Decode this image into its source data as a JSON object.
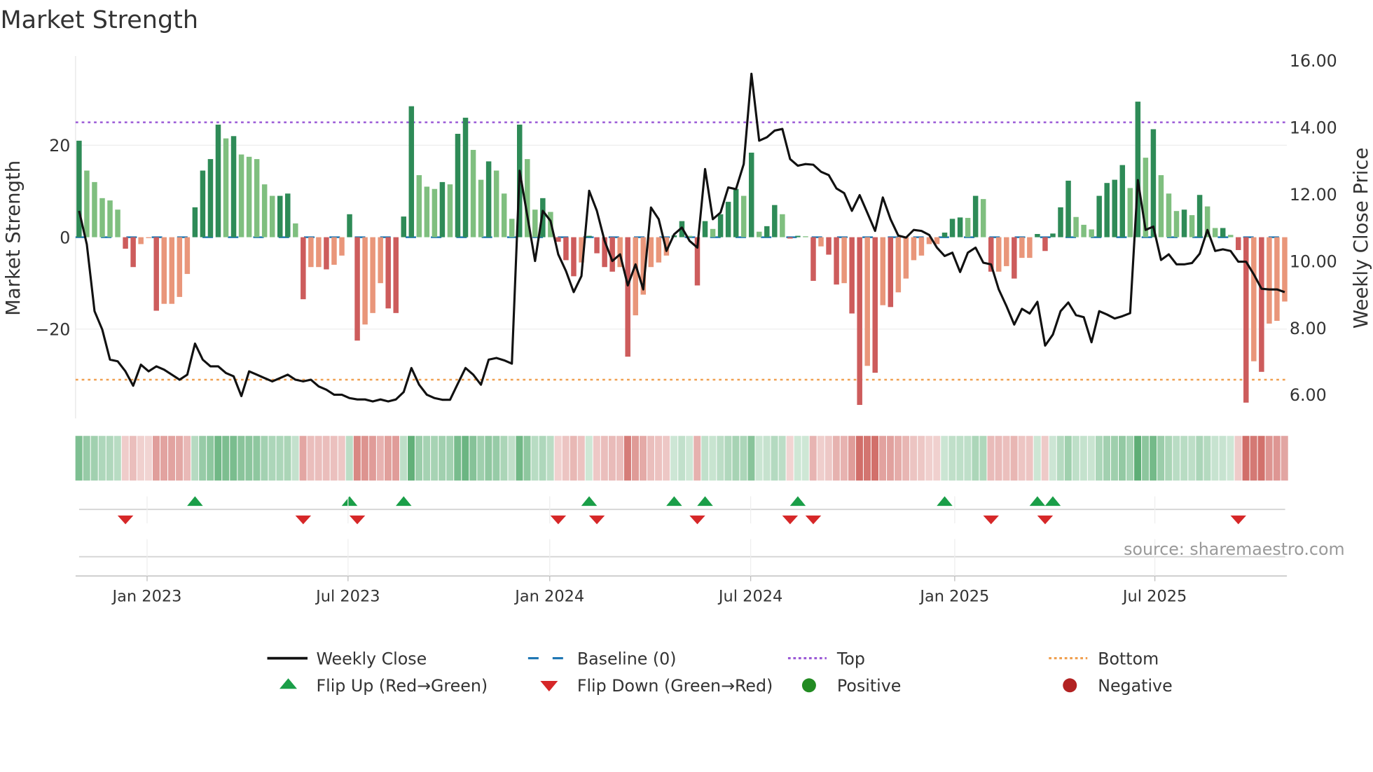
{
  "chart_data": {
    "type": "bar",
    "title": "Market Strength",
    "ylabel": "Market Strength",
    "y2label": "Weekly Close Price",
    "ylim": [
      -36.5,
      30
    ],
    "y2lim": [
      5.5,
      16.2
    ],
    "yticks": [
      {
        "v": 20,
        "label": "20"
      },
      {
        "v": 0,
        "label": "0"
      },
      {
        "v": -20,
        "label": "−20"
      }
    ],
    "y2ticks": [
      {
        "v": 16,
        "label": "16.00"
      },
      {
        "v": 14,
        "label": "14.00"
      },
      {
        "v": 12,
        "label": "12.00"
      },
      {
        "v": 10,
        "label": "10.00"
      },
      {
        "v": 8,
        "label": "8.00"
      },
      {
        "v": 6,
        "label": "6.00"
      }
    ],
    "xticks": [
      {
        "week": 8.8,
        "label": "Jan 2023"
      },
      {
        "week": 34.8,
        "label": "Jul 2023"
      },
      {
        "week": 60.9,
        "label": "Jan 2024"
      },
      {
        "week": 86.9,
        "label": "Jul 2024"
      },
      {
        "week": 113.3,
        "label": "Jan 2025"
      },
      {
        "week": 139.2,
        "label": "Jul 2025"
      }
    ],
    "top_level": 25,
    "bottom_level": -31,
    "baseline": 0,
    "strength": [
      21,
      14.5,
      12,
      8.5,
      8,
      6,
      -2.5,
      -6.5,
      -1.5,
      -0.2,
      -16,
      -14.5,
      -14.5,
      -13,
      -8,
      6.5,
      14.5,
      17,
      24.5,
      21.5,
      22,
      18,
      17.5,
      17,
      11.5,
      9,
      9,
      9.5,
      3,
      -13.5,
      -6.5,
      -6.5,
      -7,
      -6,
      -4,
      5,
      -22.5,
      -19,
      -16.5,
      -10,
      -15.5,
      -16.5,
      4.5,
      28.5,
      13.5,
      11,
      10.5,
      12,
      11.5,
      22.5,
      26,
      19,
      12.5,
      16.5,
      14.5,
      9.5,
      4,
      24.5,
      17,
      6,
      8.5,
      5.5,
      -1,
      -5,
      -8.5,
      -5.5,
      0.3,
      -3.5,
      -6.5,
      -7.5,
      -6.5,
      -26,
      -17,
      -12.5,
      -6.5,
      -5.5,
      -4,
      0.4,
      3.5,
      0.3,
      -10.5,
      3.5,
      1.8,
      5,
      7.7,
      10.5,
      9,
      18.4,
      1.2,
      2.4,
      7,
      5,
      -0.3,
      0.3,
      0.2,
      -9.5,
      -2,
      -3.8,
      -10.3,
      -10,
      -16.6,
      -36.5,
      -28,
      -29.5,
      -14.8,
      -15.2,
      -12,
      -9,
      -5,
      -4,
      -1.5,
      -1.5,
      1,
      4,
      4.3,
      4.2,
      9,
      8.3,
      -7.5,
      -7.5,
      -6.3,
      -9,
      -4.5,
      -4.5,
      0.7,
      -3,
      0.8,
      6.5,
      12.3,
      4.4,
      2.7,
      1.7,
      9,
      11.8,
      12.5,
      15.7,
      10.7,
      29.5,
      17.3,
      23.5,
      13.5,
      9.5,
      5.7,
      6,
      4.8,
      9.2,
      6.7,
      2,
      2,
      0.5,
      -2.8,
      -36,
      -27,
      -29.3,
      -18.8,
      -18.2,
      -14
    ],
    "weekly_close": [
      11.5,
      10.5,
      8.5,
      7.95,
      7.05,
      7.0,
      6.7,
      6.27,
      6.9,
      6.7,
      6.85,
      6.75,
      6.6,
      6.45,
      6.6,
      7.53,
      7.05,
      6.85,
      6.85,
      6.65,
      6.55,
      5.96,
      6.7,
      6.6,
      6.5,
      6.4,
      6.5,
      6.6,
      6.45,
      6.4,
      6.45,
      6.25,
      6.15,
      6.0,
      6.0,
      5.9,
      5.86,
      5.86,
      5.8,
      5.86,
      5.8,
      5.86,
      6.08,
      6.8,
      6.3,
      6.0,
      5.9,
      5.85,
      5.85,
      6.33,
      6.8,
      6.6,
      6.3,
      7.05,
      7.1,
      7.03,
      6.93,
      12.7,
      11.35,
      10.0,
      11.5,
      11.2,
      10.2,
      9.7,
      9.07,
      9.55,
      12.1,
      11.5,
      10.6,
      10.0,
      10.2,
      9.27,
      9.9,
      9.15,
      11.6,
      11.25,
      10.3,
      10.8,
      11.0,
      10.6,
      10.4,
      12.75,
      11.25,
      11.45,
      12.2,
      12.15,
      12.9,
      15.6,
      13.6,
      13.7,
      13.9,
      13.95,
      13.05,
      12.85,
      12.9,
      12.88,
      12.67,
      12.57,
      12.17,
      12.03,
      11.5,
      11.97,
      11.44,
      10.9,
      11.9,
      11.25,
      10.76,
      10.7,
      10.93,
      10.9,
      10.78,
      10.4,
      10.15,
      10.25,
      9.67,
      10.25,
      10.4,
      9.95,
      9.9,
      9.15,
      8.65,
      8.1,
      8.57,
      8.43,
      8.78,
      7.47,
      7.8,
      8.5,
      8.76,
      8.38,
      8.32,
      7.57,
      8.5,
      8.4,
      8.28,
      8.35,
      8.44,
      12.42,
      10.93,
      11.03,
      10.03,
      10.2,
      9.9,
      9.9,
      9.94,
      10.22,
      10.93,
      10.3,
      10.35,
      10.3,
      9.98,
      9.98,
      9.6,
      9.17,
      9.15,
      9.15,
      9.07
    ],
    "legend": {
      "placement": "bottom",
      "items": [
        {
          "label": "Weekly Close",
          "kind": "line"
        },
        {
          "label": "Baseline (0)",
          "kind": "dash"
        },
        {
          "label": "Top",
          "kind": "dot-top"
        },
        {
          "label": "Bottom",
          "kind": "dot-bottom"
        },
        {
          "label": "Flip Up (Red→Green)",
          "kind": "tri-up"
        },
        {
          "label": "Flip Down (Green→Red)",
          "kind": "tri-down"
        },
        {
          "label": "Positive",
          "kind": "dot-pos"
        },
        {
          "label": "Negative",
          "kind": "dot-neg"
        }
      ]
    },
    "annotation": "source: sharemaestro.com"
  },
  "colors": {
    "pos_strong": "#2e8b57",
    "pos_weak": "#7fbf7f",
    "neg_strong": "#cd5c5c",
    "neg_weak": "#e9967a",
    "price": "#111111",
    "baseline": "#1f77b4",
    "top": "#9b59d6",
    "bottom": "#f0a050",
    "flip_up": "#1a9e48",
    "flip_down": "#d62728",
    "positive": "#228b22",
    "negative": "#b22222"
  }
}
